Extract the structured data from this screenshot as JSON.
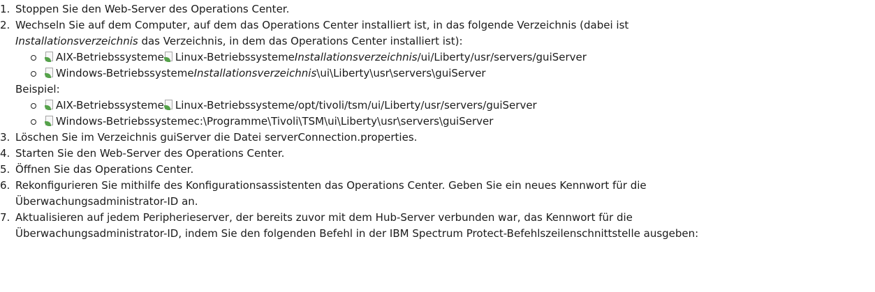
{
  "steps": [
    {
      "num": "1.",
      "text": "Stoppen Sie den Web-Server des Operations Center."
    },
    {
      "num": "2.",
      "line1": "Wechseln Sie auf dem Computer, auf dem das Operations Center installiert ist, in das folgende Verzeichnis (dabei ist",
      "line2_italic": "Installationsverzeichnis",
      "line2_rest": " das Verzeichnis, in dem das Operations Center installiert ist):",
      "paths": [
        {
          "os1": "AIX-Betriebssysteme",
          "os2": "Linux-Betriebssysteme",
          "italic": "Installationsverzeichnis",
          "rest": "/ui/Liberty/usr/servers/guiServer"
        },
        {
          "os1": "Windows-Betriebssysteme",
          "italic": "Installationsverzeichnis",
          "rest": "\\ui\\Liberty\\usr\\servers\\guiServer"
        }
      ],
      "example_label": "Beispiel:",
      "examples": [
        {
          "os1": "AIX-Betriebssysteme",
          "os2": "Linux-Betriebssysteme",
          "rest": "/opt/tivoli/tsm/ui/Liberty/usr/servers/guiServer"
        },
        {
          "os1": "Windows-Betriebssysteme",
          "rest": "c:\\Programme\\Tivoli\\TSM\\ui\\Liberty\\usr\\servers\\guiServer"
        }
      ]
    },
    {
      "num": "3.",
      "text": "Löschen Sie im Verzeichnis guiServer die Datei serverConnection.properties."
    },
    {
      "num": "4.",
      "text": "Starten Sie den Web-Server des Operations Center."
    },
    {
      "num": "5.",
      "text": "Öffnen Sie das Operations Center."
    },
    {
      "num": "6.",
      "line1": "Rekonfigurieren Sie mithilfe des Konfigurationsassistenten das Operations Center. Geben Sie ein neues Kennwort für die",
      "line2": "Überwachungsadministrator-ID an."
    },
    {
      "num": "7.",
      "line1": "Aktualisieren auf jedem Peripherieserver, der bereits zuvor mit dem Hub-Server verbunden war, das Kennwort für die",
      "line2": "Überwachungsadministrator-ID, indem Sie den folgenden Befehl in der IBM Spectrum Protect-Befehlszeilenschnittstelle ausgeben:"
    }
  ],
  "icons": {
    "os_icon": "broken-image-icon"
  }
}
